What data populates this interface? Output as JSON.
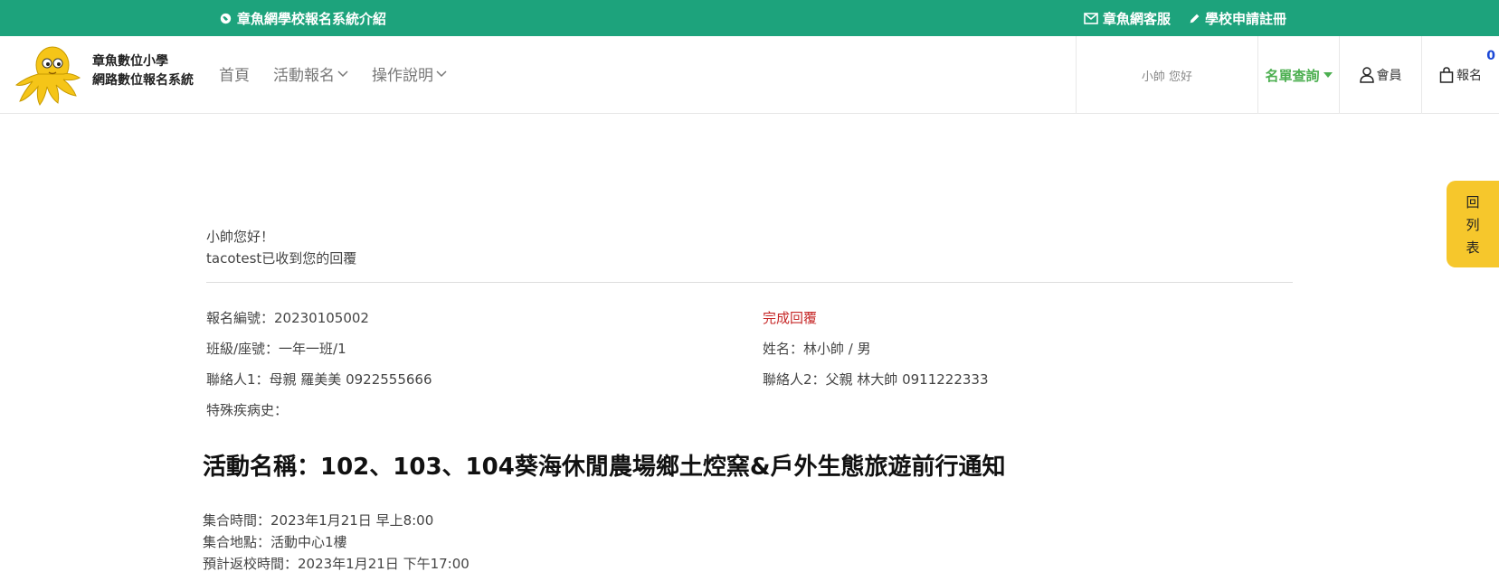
{
  "topbar": {
    "left_link": "章魚網學校報名系統介紹",
    "service": "章魚網客服",
    "register": "學校申請註冊"
  },
  "brand": {
    "line1": "章魚數位小學",
    "line2": "網路數位報名系統"
  },
  "nav": {
    "home": "首頁",
    "activity": "活動報名",
    "guide": "操作說明"
  },
  "header": {
    "greeting": "小帥 您好",
    "query": "名單查詢",
    "member": "會員",
    "cart": "報名",
    "cart_count": "0"
  },
  "float_button": {
    "chars": [
      "回",
      "列",
      "表"
    ]
  },
  "message": {
    "line1": "小帥您好！",
    "line2": "tacotest已收到您的回覆"
  },
  "details": {
    "reg_no": "報名編號：20230105002",
    "status": "完成回覆",
    "class_seat": "班級/座號：一年一班/1",
    "name": "姓名：林小帥 / 男",
    "contact1": "聯絡人1：母親 羅美美 0922555666",
    "contact2": "聯絡人2：父親 林大帥 0911222333",
    "medical": "特殊疾病史："
  },
  "activity": {
    "title": "活動名稱：102、103、104葵海休閒農場鄉土焢窯&戶外生態旅遊前行通知",
    "meet_time": "集合時間：2023年1月21日 早上8:00",
    "meet_place": "集合地點：活動中心1樓",
    "return_time": "預計返校時間：2023年1月21日 下午17:00"
  },
  "colors": {
    "topbar": "#1da37c",
    "query": "#4caf50",
    "status": "#c62828",
    "float": "#f6c72c",
    "badge": "#1a47d6"
  }
}
